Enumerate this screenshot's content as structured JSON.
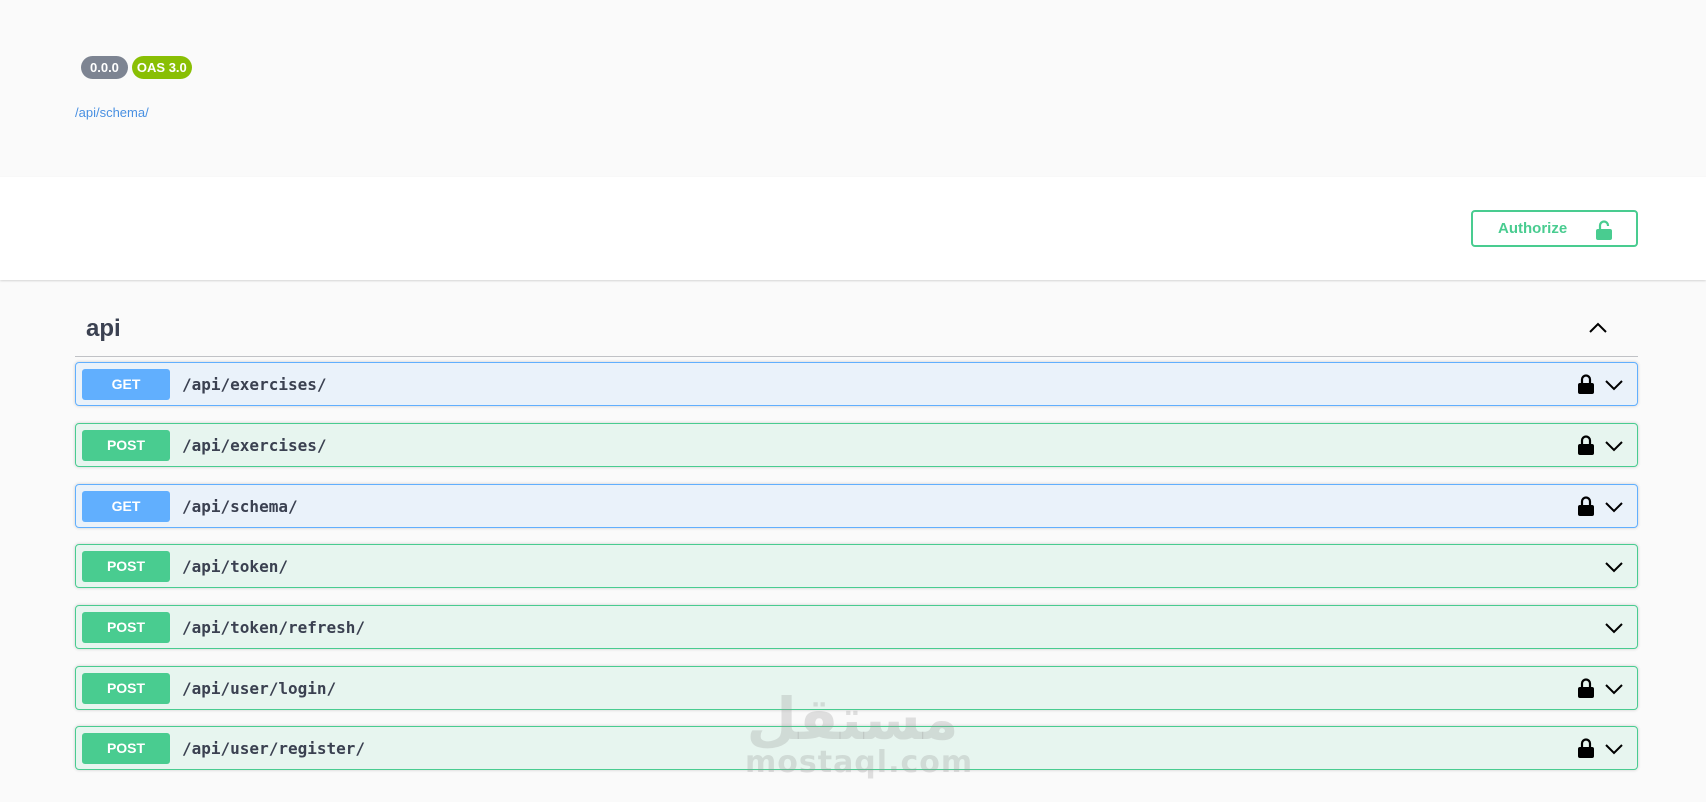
{
  "info": {
    "version_badge": "0.0.0",
    "oas_badge": "OAS 3.0",
    "schema_link": "/api/schema/"
  },
  "auth": {
    "authorize_label": "Authorize"
  },
  "tag": {
    "name": "api"
  },
  "operations": [
    {
      "method": "GET",
      "path": "/api/exercises/"
    },
    {
      "method": "POST",
      "path": "/api/exercises/"
    },
    {
      "method": "GET",
      "path": "/api/schema/"
    },
    {
      "method": "POST",
      "path": "/api/token/"
    },
    {
      "method": "POST",
      "path": "/api/token/refresh/"
    },
    {
      "method": "POST",
      "path": "/api/user/login/"
    },
    {
      "method": "POST",
      "path": "/api/user/register/"
    }
  ],
  "watermark": {
    "arabic": "مستقل",
    "latin": "mostaql.com"
  },
  "colors": {
    "get": "#61affe",
    "post": "#49cc90",
    "version_badge": "#7d8492",
    "oas_badge": "#89bf04"
  }
}
